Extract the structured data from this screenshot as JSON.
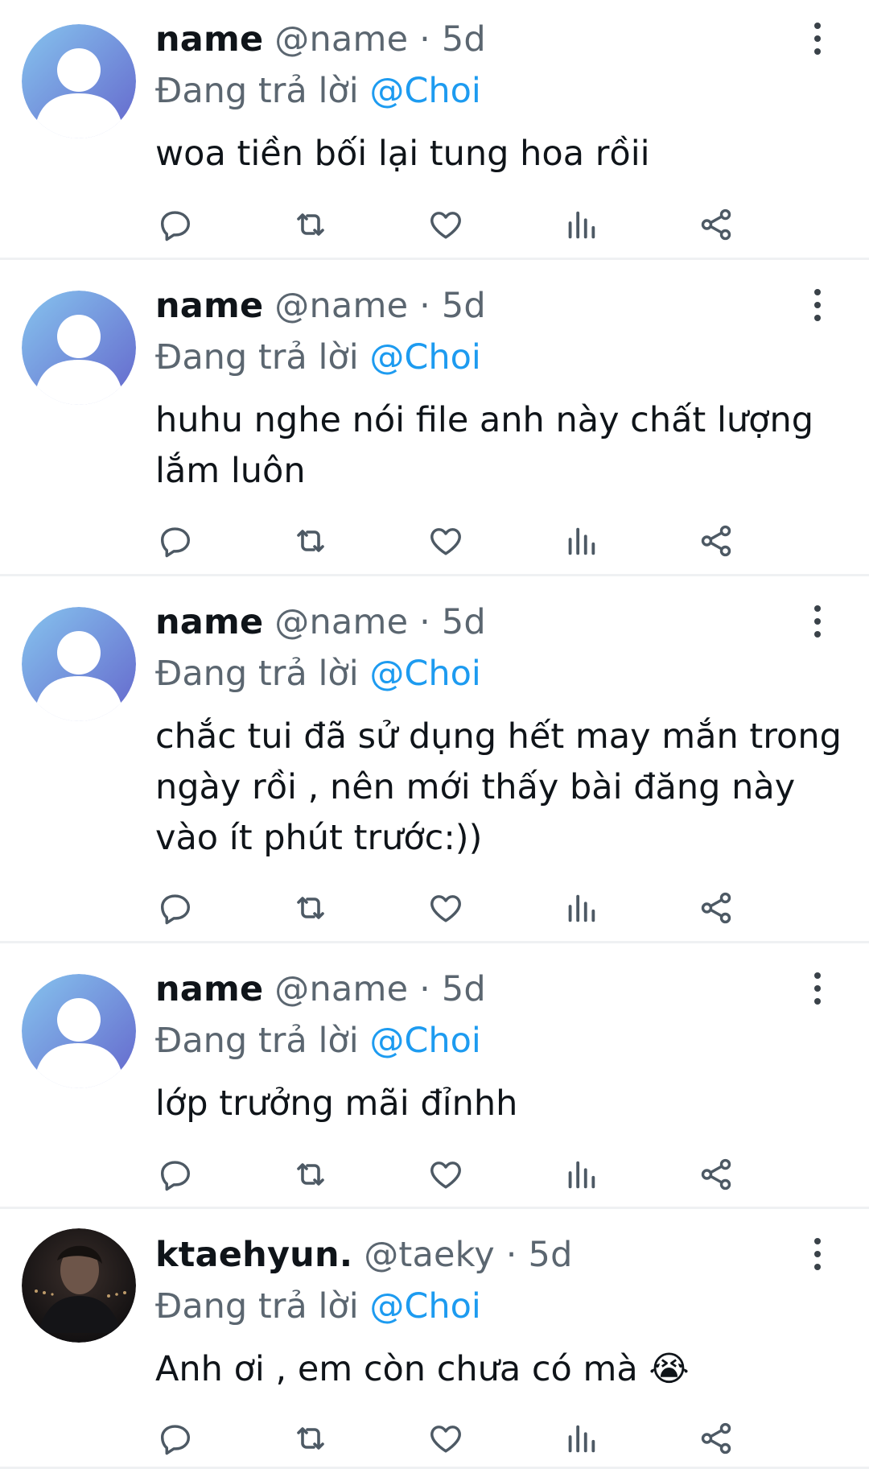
{
  "replies": [
    {
      "name": "name",
      "handle": "@name",
      "sep": "·",
      "time": "5d",
      "replying_prefix": "Đang trả lời",
      "replying_to": "@Choi",
      "text": "woa tiền bối lại tung hoa rồii",
      "avatar": "default-avatar"
    },
    {
      "name": "name",
      "handle": "@name",
      "sep": "·",
      "time": "5d",
      "replying_prefix": "Đang trả lời",
      "replying_to": "@Choi",
      "text": "huhu nghe nói file anh này chất lượng lắm luôn",
      "avatar": "default-avatar"
    },
    {
      "name": "name",
      "handle": "@name",
      "sep": "·",
      "time": "5d",
      "replying_prefix": "Đang trả lời",
      "replying_to": "@Choi",
      "text": "chắc tui đã sử dụng hết may mắn trong ngày rồi , nên mới thấy bài đăng này vào ít phút trước:))",
      "avatar": "default-avatar"
    },
    {
      "name": "name",
      "handle": "@name",
      "sep": "·",
      "time": "5d",
      "replying_prefix": "Đang trả lời",
      "replying_to": "@Choi",
      "text": "lớp trưởng mãi đỉnhh",
      "avatar": "default-avatar"
    },
    {
      "name": "ktaehyun.",
      "handle": "@taeky",
      "sep": "·",
      "time": "5d",
      "replying_prefix": "Đang trả lời",
      "replying_to": "@Choi",
      "text": "Anh ơi , em còn chưa có mà 😭",
      "avatar": "photo-avatar"
    }
  ],
  "icons": {
    "reply": "reply-icon",
    "repost": "repost-icon",
    "like": "like-icon",
    "views": "views-icon",
    "share": "share-icon",
    "more": "more-icon"
  },
  "colors": {
    "text": "#0f1419",
    "muted": "#5b6670",
    "mention": "#1d9bf0",
    "icon": "#4d5964",
    "divider": "#eff1f3",
    "avatar_gradient_start": "#7bb6ea",
    "avatar_gradient_end": "#6b6bd0"
  }
}
